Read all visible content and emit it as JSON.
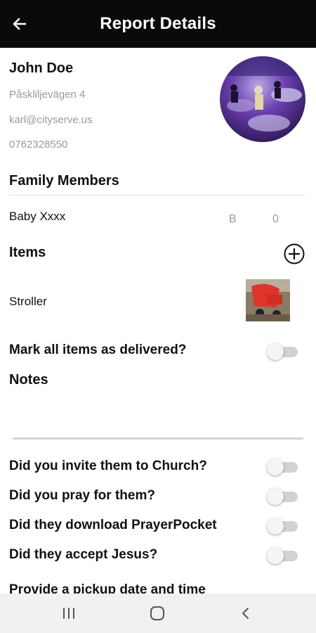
{
  "header": {
    "title": "Report Details",
    "back_icon": "arrow-left-icon"
  },
  "profile": {
    "name": "John Doe",
    "address": "Påskliljevägen 4",
    "email": "karl@cityserve.us",
    "phone": "0762328550",
    "avatar": "event-photo"
  },
  "family": {
    "heading": "Family Members",
    "members": [
      {
        "name": "Baby Xxxx",
        "gender": "B",
        "age": "0"
      }
    ]
  },
  "items": {
    "heading": "Items",
    "add_icon": "plus-circle-icon",
    "list": [
      {
        "name": "Stroller",
        "thumbnail": "stroller-photo"
      }
    ]
  },
  "delivery": {
    "label": "Mark all items as delivered?",
    "checked": false
  },
  "notes": {
    "heading": "Notes",
    "value": ""
  },
  "questions": [
    {
      "label": "Did you invite them to Church?",
      "checked": false
    },
    {
      "label": "Did you pray for them?",
      "checked": false
    },
    {
      "label": "Did they download PrayerPocket",
      "checked": false
    },
    {
      "label": "Did they accept Jesus?",
      "checked": false
    }
  ],
  "pickup": {
    "label": "Provide a pickup date and time"
  },
  "system_nav": {
    "recent_icon": "recent-apps-icon",
    "home_icon": "home-icon",
    "back_icon": "system-back-icon"
  },
  "colors": {
    "appbar": "#0a0a0a",
    "secondary_text": "#9a9a9a",
    "toggle_track": "#d2d2d2"
  }
}
